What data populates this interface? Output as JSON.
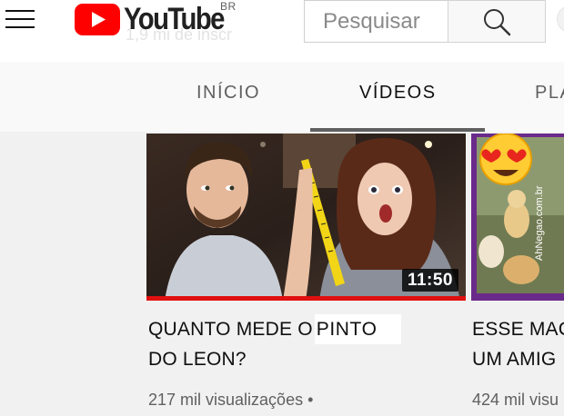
{
  "header": {
    "logo_text": "YouTube",
    "region": "BR",
    "ghost_text": "1,9 mi de inscr",
    "search_placeholder": "Pesquisar"
  },
  "tabs": [
    {
      "label": "INÍCIO",
      "selected": false
    },
    {
      "label": "VÍDEOS",
      "selected": true
    },
    {
      "label": "PLA",
      "selected": false
    }
  ],
  "videos": [
    {
      "duration": "11:50",
      "title_line1_before": "QUANTO MEDE O",
      "title_highlight": "PINTO",
      "title_line2": "DO LEON?",
      "views": "217 mil visualizações",
      "separator": "•",
      "watched_fraction": 1.0
    },
    {
      "title_line1": "ESSE MAC",
      "title_line2": "UM AMIG",
      "views": "424 mil visu",
      "watermark": "AhNegao.com.br"
    }
  ],
  "colors": {
    "brand_red": "#ff0000",
    "progress_red": "#e01010",
    "text_primary": "#0f0f0f",
    "text_secondary": "#606060",
    "background": "#f1f1f1"
  }
}
